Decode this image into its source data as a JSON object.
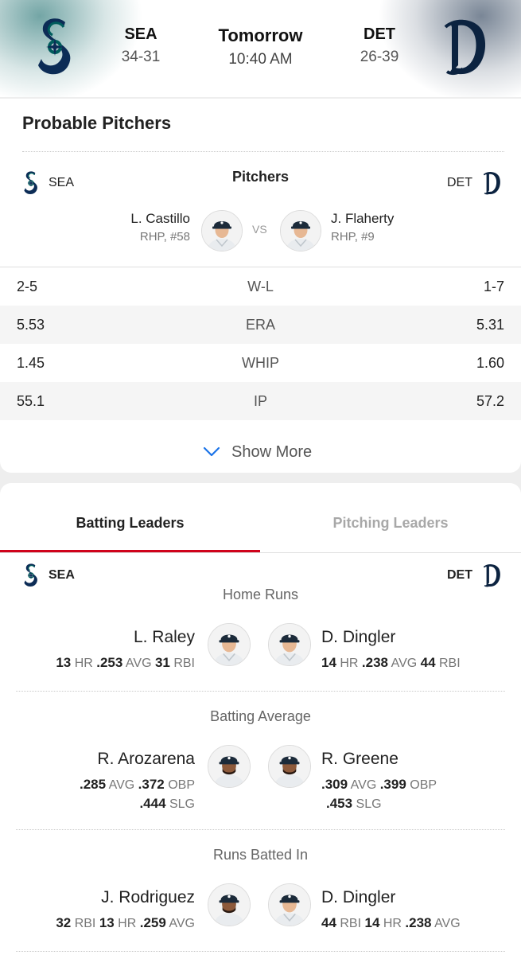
{
  "header": {
    "away": {
      "abbr": "SEA",
      "record": "34-31"
    },
    "home": {
      "abbr": "DET",
      "record": "26-39"
    },
    "game": {
      "day": "Tomorrow",
      "time": "10:40 AM"
    }
  },
  "probable_pitchers": {
    "title": "Probable Pitchers",
    "away_abbr": "SEA",
    "home_abbr": "DET",
    "heading": "Pitchers",
    "vs_label": "VS",
    "away_pitcher": {
      "name": "L. Castillo",
      "info": "RHP, #58"
    },
    "home_pitcher": {
      "name": "J. Flaherty",
      "info": "RHP, #9"
    },
    "stats": [
      {
        "label": "W-L",
        "away": "2-5",
        "home": "1-7"
      },
      {
        "label": "ERA",
        "away": "5.53",
        "home": "5.31"
      },
      {
        "label": "WHIP",
        "away": "1.45",
        "home": "1.60"
      },
      {
        "label": "IP",
        "away": "55.1",
        "home": "57.2"
      }
    ],
    "show_more": "Show More"
  },
  "leaders": {
    "tabs": [
      "Batting Leaders",
      "Pitching Leaders"
    ],
    "away_abbr": "SEA",
    "home_abbr": "DET",
    "categories": [
      {
        "title": "Home Runs",
        "away": {
          "name": "L. Raley",
          "line1": [
            [
              "13",
              "HR"
            ],
            [
              ".253",
              "AVG"
            ],
            [
              "31",
              "RBI"
            ]
          ],
          "line2": []
        },
        "home": {
          "name": "D. Dingler",
          "line1": [
            [
              "14",
              "HR"
            ],
            [
              ".238",
              "AVG"
            ],
            [
              "44",
              "RBI"
            ]
          ],
          "line2": []
        }
      },
      {
        "title": "Batting Average",
        "away": {
          "name": "R. Arozarena",
          "line1": [
            [
              ".285",
              "AVG"
            ],
            [
              ".372",
              "OBP"
            ]
          ],
          "line2": [
            [
              ".444",
              "SLG"
            ]
          ]
        },
        "home": {
          "name": "R. Greene",
          "line1": [
            [
              ".309",
              "AVG"
            ],
            [
              ".399",
              "OBP"
            ]
          ],
          "line2": [
            [
              ".453",
              "SLG"
            ]
          ]
        }
      },
      {
        "title": "Runs Batted In",
        "away": {
          "name": "J. Rodriguez",
          "line1": [
            [
              "32",
              "RBI"
            ],
            [
              "13",
              "HR"
            ],
            [
              ".259",
              "AVG"
            ]
          ],
          "line2": []
        },
        "home": {
          "name": "D. Dingler",
          "line1": [
            [
              "44",
              "RBI"
            ],
            [
              "14",
              "HR"
            ],
            [
              ".238",
              "AVG"
            ]
          ],
          "line2": []
        }
      }
    ]
  },
  "colors": {
    "mariners_navy": "#0C2C56",
    "mariners_teal": "#005C5C",
    "tigers_navy": "#0C2340",
    "accent_red": "#D0021B",
    "link_blue": "#1A73E8"
  },
  "icons": {
    "away_logo": "mariners-logo-icon",
    "home_logo": "tigers-logo-icon",
    "show_more": "chevron-down-icon",
    "player": "player-headshot"
  }
}
